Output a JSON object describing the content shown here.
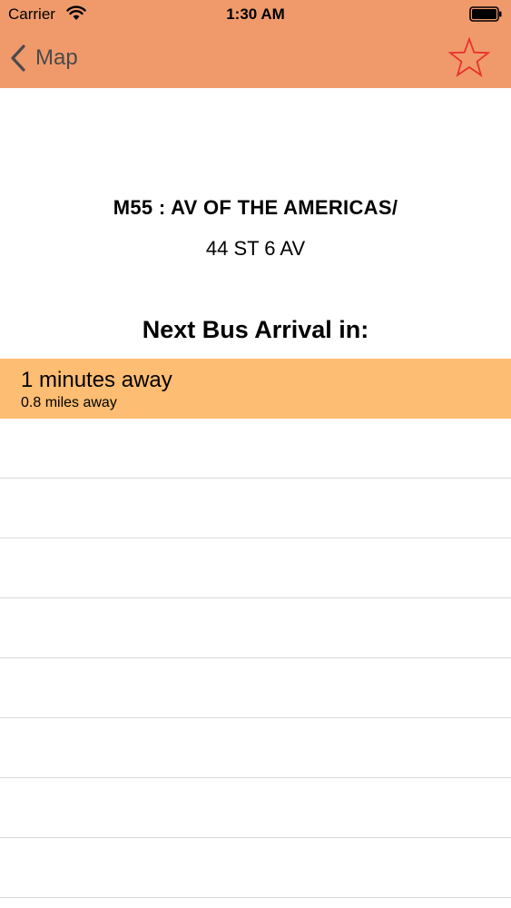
{
  "status_bar": {
    "carrier": "Carrier",
    "time": "1:30 AM"
  },
  "nav": {
    "back_label": "Map",
    "accent_color": "#f09a6c",
    "star_color": "#e8322c"
  },
  "stop": {
    "title": "M55 : AV OF THE AMERICAS/",
    "subtitle": "44 ST 6 AV"
  },
  "arrivals": {
    "section_title": "Next Bus Arrival in:",
    "highlight_color": "#fdbd72",
    "items": [
      {
        "time_away": "1 minutes away",
        "distance_away": "0.8 miles away"
      }
    ]
  }
}
